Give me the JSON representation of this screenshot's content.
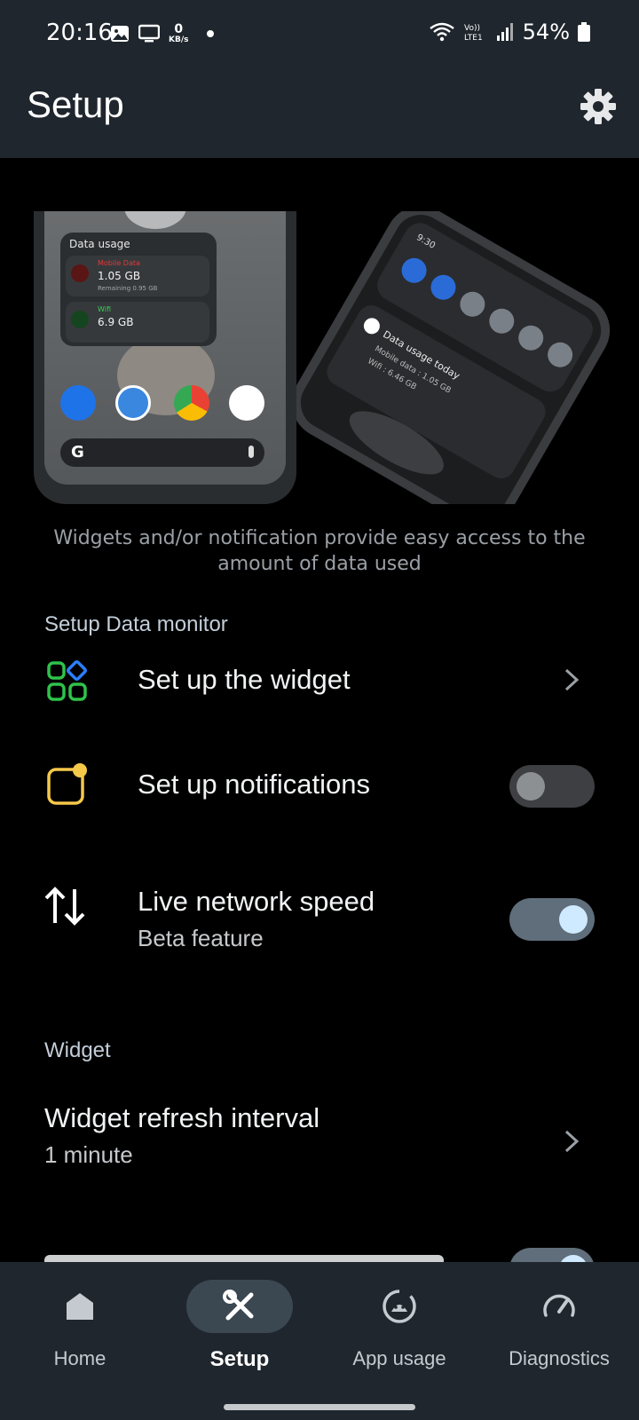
{
  "status_bar": {
    "time": "20:16",
    "net_speed_value": "0",
    "net_speed_unit": "KB/s",
    "battery": "54%"
  },
  "app_bar": {
    "title": "Setup"
  },
  "hero": {
    "widget_title": "Data usage",
    "mobile_label": "Mobile Data",
    "mobile_value": "1.05 GB",
    "mobile_remaining": "Remaining 0.95 GB",
    "wifi_label": "Wifi",
    "wifi_value": "6.9 GB",
    "notif_time": "9:30",
    "notif_title": "Data usage today",
    "notif_mobile": "Mobile data : 1.05 GB",
    "notif_wifi": "Wifi : 6.46 GB",
    "caption": "Widgets and/or notification provide easy access to the amount of data used"
  },
  "sections": {
    "data_monitor": "Setup Data monitor",
    "widget": "Widget"
  },
  "rows": {
    "widget_setup": {
      "title": "Set up the widget"
    },
    "notifications": {
      "title": "Set up notifications",
      "enabled": false
    },
    "live_speed": {
      "title": "Live network speed",
      "subtitle": "Beta feature",
      "enabled": true
    },
    "refresh_interval": {
      "title": "Widget refresh interval",
      "value": "1 minute"
    }
  },
  "bottom_nav": {
    "items": [
      {
        "label": "Home",
        "icon": "home-icon"
      },
      {
        "label": "Setup",
        "icon": "tools-icon",
        "active": true
      },
      {
        "label": "App usage",
        "icon": "android-icon"
      },
      {
        "label": "Diagnostics",
        "icon": "speedometer-icon"
      }
    ]
  },
  "colors": {
    "bar_bg": "#1f262d",
    "accent": "#cfe9ff",
    "widget_icon_green": "#2fc24a",
    "widget_icon_blue": "#2a7fff",
    "notif_icon_yellow": "#f5c84a"
  }
}
